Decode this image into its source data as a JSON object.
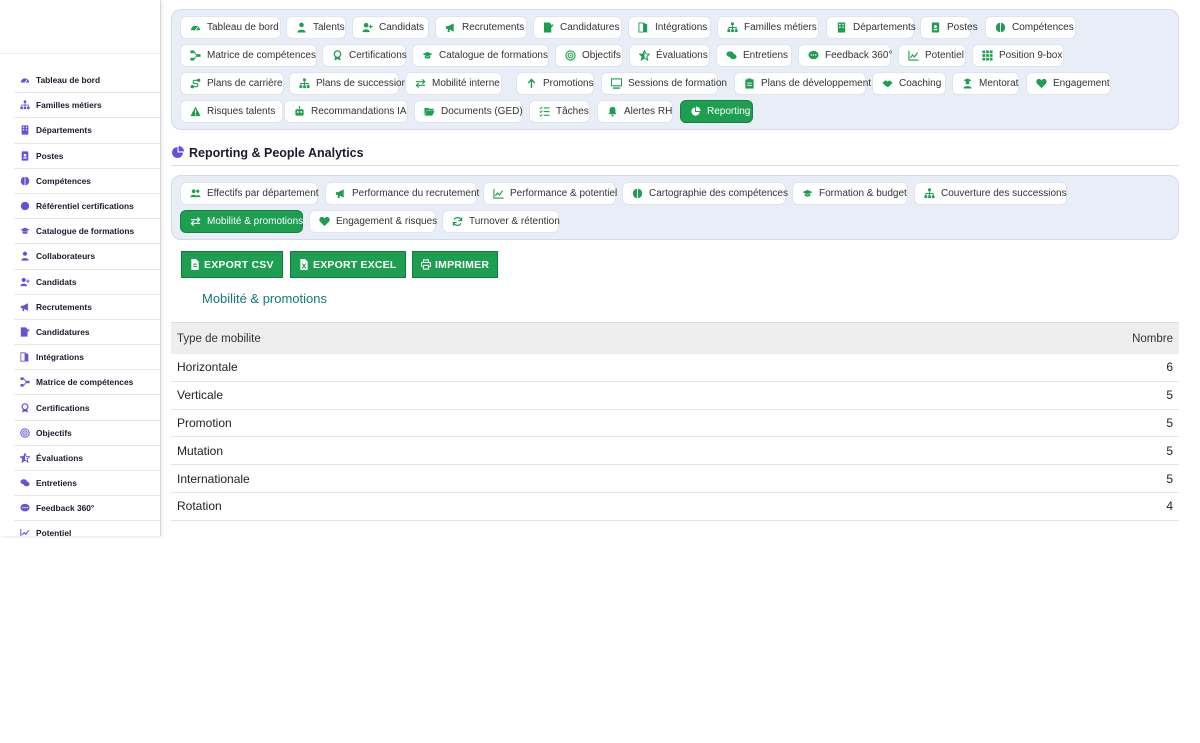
{
  "sidebar": {
    "items": [
      {
        "label": "Tableau de bord",
        "icon": "dashboard-icon"
      },
      {
        "label": "Familles métiers",
        "icon": "sitemap-icon"
      },
      {
        "label": "Départements",
        "icon": "building-icon"
      },
      {
        "label": "Postes",
        "icon": "id-badge-icon"
      },
      {
        "label": "Compétences",
        "icon": "brain-icon"
      },
      {
        "label": "Référentiel certifications",
        "icon": "certificate-icon"
      },
      {
        "label": "Catalogue de formations",
        "icon": "graduation-cap-icon"
      },
      {
        "label": "Collaborateurs",
        "icon": "user-tie-icon"
      },
      {
        "label": "Candidats",
        "icon": "user-plus-icon"
      },
      {
        "label": "Recrutements",
        "icon": "bullhorn-icon"
      },
      {
        "label": "Candidatures",
        "icon": "file-signature-icon"
      },
      {
        "label": "Intégrations",
        "icon": "door-open-icon"
      },
      {
        "label": "Matrice de compétences",
        "icon": "project-diagram-icon"
      },
      {
        "label": "Certifications",
        "icon": "award-icon"
      },
      {
        "label": "Objectifs",
        "icon": "bullseye-icon"
      },
      {
        "label": "Évaluations",
        "icon": "star-half-icon"
      },
      {
        "label": "Entretiens",
        "icon": "comments-icon"
      },
      {
        "label": "Feedback 360°",
        "icon": "comment-dots-icon"
      },
      {
        "label": "Potentiel",
        "icon": "chart-line-icon"
      }
    ]
  },
  "nav": {
    "items": [
      {
        "label": "Tableau de bord",
        "icon": "dashboard-icon",
        "active": false
      },
      {
        "label": "Talents",
        "icon": "user-tie-icon",
        "active": false
      },
      {
        "label": "Candidats",
        "icon": "user-plus-icon",
        "active": false
      },
      {
        "label": "Recrutements",
        "icon": "bullhorn-icon",
        "active": false
      },
      {
        "label": "Candidatures",
        "icon": "file-signature-icon",
        "active": false
      },
      {
        "label": "Intégrations",
        "icon": "door-open-icon",
        "active": false
      },
      {
        "label": "Familles métiers",
        "icon": "sitemap-icon",
        "active": false
      },
      {
        "label": "Départements",
        "icon": "building-icon",
        "active": false
      },
      {
        "label": "Postes",
        "icon": "id-badge-icon",
        "active": false
      },
      {
        "label": "Compétences",
        "icon": "brain-icon",
        "active": false
      },
      {
        "label": "Matrice de compétences",
        "icon": "project-diagram-icon",
        "active": false
      },
      {
        "label": "Certifications",
        "icon": "award-icon",
        "active": false
      },
      {
        "label": "Catalogue de formations",
        "icon": "graduation-cap-icon",
        "active": false
      },
      {
        "label": "Objectifs",
        "icon": "bullseye-icon",
        "active": false
      },
      {
        "label": "Évaluations",
        "icon": "star-half-icon",
        "active": false
      },
      {
        "label": "Entretiens",
        "icon": "comments-icon",
        "active": false
      },
      {
        "label": "Feedback 360°",
        "icon": "comment-dots-icon",
        "active": false
      },
      {
        "label": "Potentiel",
        "icon": "chart-line-icon",
        "active": false
      },
      {
        "label": "Position 9-box",
        "icon": "grid-icon",
        "active": false
      },
      {
        "label": "Plans de carrière",
        "icon": "route-icon",
        "active": false
      },
      {
        "label": "Plans de succession",
        "icon": "sitemap-icon",
        "active": false
      },
      {
        "label": "Mobilité interne",
        "icon": "exchange-icon",
        "active": false
      },
      {
        "label": "Promotions",
        "icon": "arrow-up-icon",
        "active": false
      },
      {
        "label": "Sessions de formation",
        "icon": "chalkboard-icon",
        "active": false
      },
      {
        "label": "Plans de développement",
        "icon": "clipboard-list-icon",
        "active": false
      },
      {
        "label": "Coaching",
        "icon": "handshake-icon",
        "active": false
      },
      {
        "label": "Mentorat",
        "icon": "user-graduate-icon",
        "active": false
      },
      {
        "label": "Engagement",
        "icon": "heart-icon",
        "active": false
      },
      {
        "label": "Risques talents",
        "icon": "warning-icon",
        "active": false
      },
      {
        "label": "Recommandations IA",
        "icon": "robot-icon",
        "active": false
      },
      {
        "label": "Documents (GED)",
        "icon": "folder-open-icon",
        "active": false
      },
      {
        "label": "Tâches",
        "icon": "tasks-icon",
        "active": false
      },
      {
        "label": "Alertes RH",
        "icon": "bell-icon",
        "active": false
      },
      {
        "label": "Reporting",
        "icon": "chart-pie-icon",
        "active": true
      }
    ]
  },
  "section": {
    "title": "Reporting & People Analytics",
    "icon": "chart-pie-icon"
  },
  "report_tabs": [
    {
      "label": "Effectifs par département",
      "icon": "users-icon",
      "active": false
    },
    {
      "label": "Performance du recrutement",
      "icon": "bullhorn-icon",
      "active": false
    },
    {
      "label": "Performance & potentiel",
      "icon": "chart-line-icon",
      "active": false
    },
    {
      "label": "Cartographie des compétences",
      "icon": "brain-icon",
      "active": false
    },
    {
      "label": "Formation & budget",
      "icon": "graduation-cap-icon",
      "active": false
    },
    {
      "label": "Couverture des successions",
      "icon": "sitemap-icon",
      "active": false
    },
    {
      "label": "Mobilité & promotions",
      "icon": "exchange-icon",
      "active": true
    },
    {
      "label": "Engagement & risques",
      "icon": "heart-icon",
      "active": false
    },
    {
      "label": "Turnover & rétention",
      "icon": "sync-icon",
      "active": false
    }
  ],
  "actions": {
    "export_csv": "EXPORT CSV",
    "export_excel": "EXPORT EXCEL",
    "print": "IMPRIMER"
  },
  "report": {
    "title": "Mobilité & promotions",
    "columns": [
      "Type de mobilite",
      "Nombre"
    ],
    "rows": [
      {
        "type": "Horizontale",
        "count": "6"
      },
      {
        "type": "Verticale",
        "count": "5"
      },
      {
        "type": "Promotion",
        "count": "5"
      },
      {
        "type": "Mutation",
        "count": "5"
      },
      {
        "type": "Internationale",
        "count": "5"
      },
      {
        "type": "Rotation",
        "count": "4"
      }
    ]
  },
  "colors": {
    "sidebar_icon": "#6a4fd8",
    "nav_icon": "#1e9e50",
    "active_bg": "#1e9e50",
    "report_title": "#117a78"
  }
}
